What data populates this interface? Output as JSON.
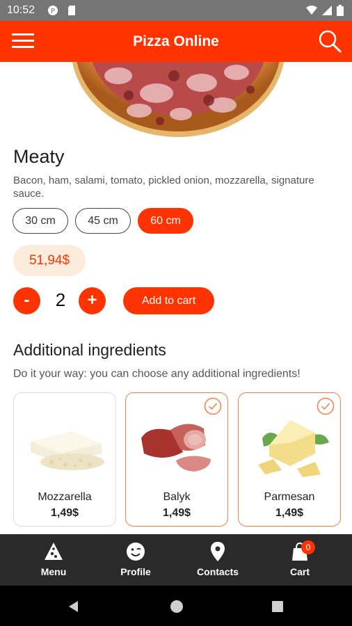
{
  "status_bar": {
    "time": "10:52"
  },
  "app_bar": {
    "title": "Pizza Online",
    "menu_icon": "hamburger-icon",
    "search_icon": "search-icon"
  },
  "product": {
    "name": "Meaty",
    "description": "Bacon, ham, salami, tomato, pickled onion, mozzarella, signature sauce.",
    "sizes": [
      {
        "label": "30 cm",
        "selected": false
      },
      {
        "label": "45 cm",
        "selected": false
      },
      {
        "label": "60 cm",
        "selected": true
      }
    ],
    "price": "51,94$",
    "quantity": "2",
    "minus_label": "-",
    "plus_label": "+",
    "add_to_cart_label": "Add to cart"
  },
  "additional": {
    "title": "Additional ingredients",
    "subtitle": "Do it your way: you can choose any additional ingredients!",
    "items": [
      {
        "name": "Mozzarella",
        "price": "1,49$",
        "selected": false
      },
      {
        "name": "Balyk",
        "price": "1,49$",
        "selected": true
      },
      {
        "name": "Parmesan",
        "price": "1,49$",
        "selected": true
      }
    ]
  },
  "bottom_nav": {
    "items": [
      {
        "label": "Menu",
        "icon": "pizza-slice-icon"
      },
      {
        "label": "Profile",
        "icon": "smiley-icon"
      },
      {
        "label": "Contacts",
        "icon": "location-pin-icon"
      },
      {
        "label": "Cart",
        "icon": "cart-bag-icon",
        "badge": "0"
      }
    ]
  },
  "colors": {
    "accent": "#ff3300",
    "price_bg": "#fdecdc",
    "nav_bg": "#2a2a2a",
    "status_bar": "#757575"
  }
}
